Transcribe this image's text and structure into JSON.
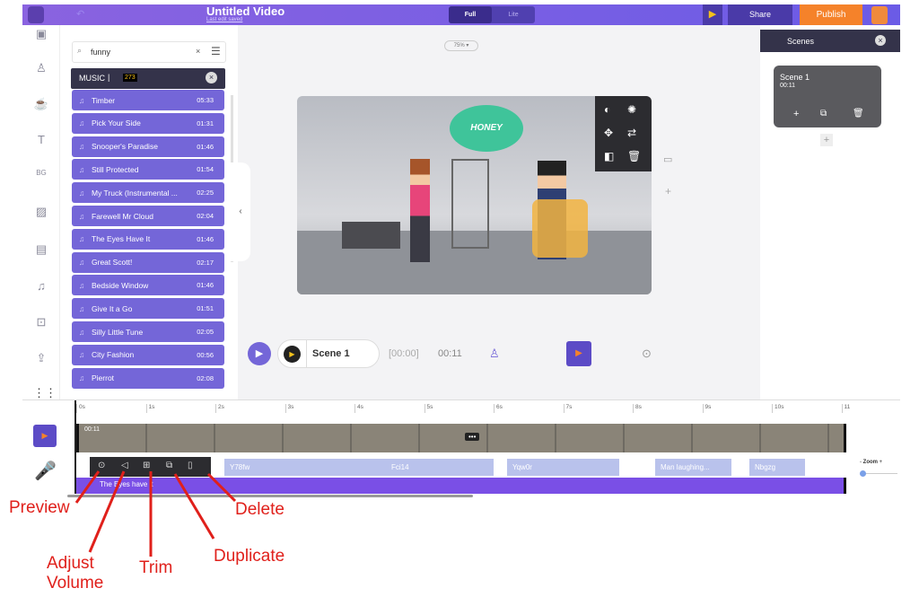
{
  "header": {
    "title": "Untitled Video",
    "subtitle": "Last edit saved",
    "modes": [
      "Full",
      "Lite"
    ],
    "share": "Share",
    "publish": "Publish"
  },
  "zoom_level": "75%",
  "search": {
    "value": "funny"
  },
  "music": {
    "label": "MUSIC",
    "count": "273",
    "items": [
      {
        "name": "Timber",
        "dur": "05:33"
      },
      {
        "name": "Pick Your Side",
        "dur": "01:31"
      },
      {
        "name": "Snooper's Paradise",
        "dur": "01:46"
      },
      {
        "name": "Still Protected",
        "dur": "01:54"
      },
      {
        "name": "My Truck (Instrumental ...",
        "dur": "02:25"
      },
      {
        "name": "Farewell Mr Cloud",
        "dur": "02:04"
      },
      {
        "name": "The Eyes Have It",
        "dur": "01:46"
      },
      {
        "name": "Great Scott!",
        "dur": "02:17"
      },
      {
        "name": "Bedside Window",
        "dur": "01:46"
      },
      {
        "name": "Give It a Go",
        "dur": "01:51"
      },
      {
        "name": "Silly Little Tune",
        "dur": "02:05"
      },
      {
        "name": "City Fashion",
        "dur": "00:56"
      },
      {
        "name": "Pierrot",
        "dur": "02:08"
      }
    ]
  },
  "video": {
    "bubble": "HONEY"
  },
  "player": {
    "scene": "Scene 1",
    "start": "[00:00]",
    "end": "00:11"
  },
  "scenes": {
    "title": "Scenes",
    "card": {
      "name": "Scene 1",
      "dur": "00:11"
    }
  },
  "timeline": {
    "ticks": [
      "0s",
      "1s",
      "2s",
      "3s",
      "4s",
      "5s",
      "6s",
      "7s",
      "8s",
      "9s",
      "10s",
      "11"
    ],
    "scene_dur": "00:11",
    "clips": [
      "Y78fw",
      "Fci14",
      "Yqw0r",
      "Man laughing...",
      "Nbgzg"
    ],
    "music_track": "The Eyes have it",
    "zoom": "Zoom"
  },
  "annotations": {
    "preview": "Preview",
    "volume": "Adjust\nVolume",
    "trim": "Trim",
    "duplicate": "Duplicate",
    "delete": "Delete"
  },
  "colors": {
    "accent": "#7466d8",
    "publish": "#f5822a",
    "music_track": "#7a4fe6"
  }
}
